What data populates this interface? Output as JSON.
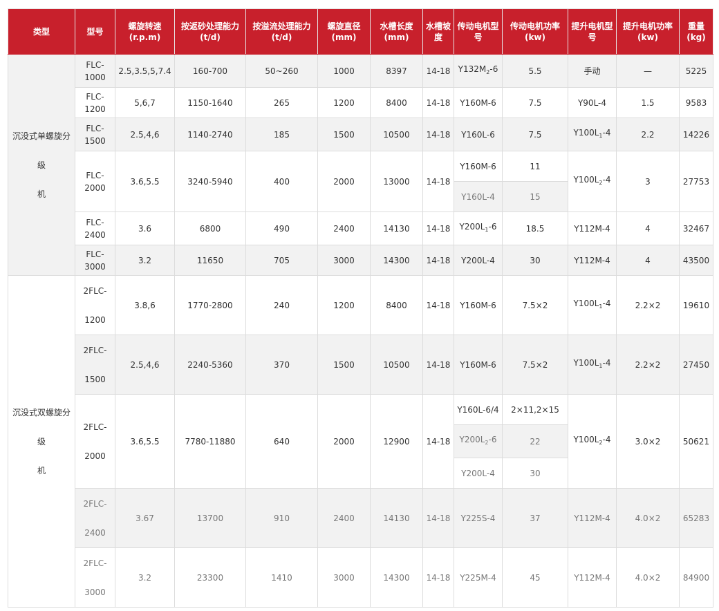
{
  "headers": [
    "类型",
    "型号",
    "螺旋转速\n(r.p.m)",
    "按返砂处理能力\n(t/d)",
    "按溢流处理能力\n(t/d)",
    "螺旋直径\n(mm)",
    "水槽长度\n(mm)",
    "水槽坡度",
    "传动电机型号",
    "传动电机功率\n(kw)",
    "提升电机型号",
    "提升电机功率\n(kw)",
    "重量\n(kg)"
  ],
  "categories": {
    "single_line1": "沉没式单螺旋分级",
    "single_line2": "机",
    "double_line1": "沉没式双螺旋分级",
    "double_line2": "机"
  },
  "rows": {
    "r1": {
      "model": "FLC-1000",
      "speed": "2.5,3.5,5,7.4",
      "sand": "160-700",
      "overflow": "50~260",
      "diam": "1000",
      "length": "8397",
      "slope": "14-18",
      "drive_model": "Y132M",
      "drive_sub": "2",
      "drive_tail": "-6",
      "drive_power": "5.5",
      "lift_model": "手动",
      "lift_power": "—",
      "weight": "5225"
    },
    "r2": {
      "model": "FLC-1200",
      "speed": "5,6,7",
      "sand": "1150-1640",
      "overflow": "265",
      "diam": "1200",
      "length": "8400",
      "slope": "14-18",
      "drive_model": "Y160M-6",
      "drive_power": "7.5",
      "lift_model": "Y90L-4",
      "lift_power": "1.5",
      "weight": "9583"
    },
    "r3": {
      "model": "FLC-1500",
      "speed": "2.5,4,6",
      "sand": "1140-2740",
      "overflow": "185",
      "diam": "1500",
      "length": "10500",
      "slope": "14-18",
      "drive_model": "Y160L-6",
      "drive_power": "7.5",
      "lift_model": "Y100L",
      "lift_sub": "1",
      "lift_tail": "-4",
      "lift_power": "2.2",
      "weight": "14226"
    },
    "r4": {
      "model": "FLC-2000",
      "speed": "3.6,5.5",
      "sand": "3240-5940",
      "overflow": "400",
      "diam": "2000",
      "length": "13000",
      "slope": "14-18",
      "drive_model_a": "Y160M-6",
      "drive_power_a": "11",
      "drive_model_b": "Y160L-4",
      "drive_power_b": "15",
      "lift_model": "Y100L",
      "lift_sub": "2",
      "lift_tail": "-4",
      "lift_power": "3",
      "weight": "27753"
    },
    "r5": {
      "model": "FLC-2400",
      "speed": "3.6",
      "sand": "6800",
      "overflow": "490",
      "diam": "2400",
      "length": "14130",
      "slope": "14-18",
      "drive_model": "Y200L",
      "drive_sub": "1",
      "drive_tail": "-6",
      "drive_power": "18.5",
      "lift_model": "Y112M-4",
      "lift_power": "4",
      "weight": "32467"
    },
    "r6": {
      "model": "FLC-3000",
      "speed": "3.2",
      "sand": "11650",
      "overflow": "705",
      "diam": "3000",
      "length": "14300",
      "slope": "14-18",
      "drive_model": "Y200L-4",
      "drive_power": "30",
      "lift_model": "Y112M-4",
      "lift_power": "4",
      "weight": "43500"
    },
    "r7": {
      "model_a": "2FLC-",
      "model_b": "1200",
      "speed": "3.8,6",
      "sand": "1770-2800",
      "overflow": "240",
      "diam": "1200",
      "length": "8400",
      "slope": "14-18",
      "drive_model": "Y160M-6",
      "drive_power": "7.5×2",
      "lift_model": "Y100L",
      "lift_sub": "1",
      "lift_tail": "-4",
      "lift_power": "2.2×2",
      "weight": "19610"
    },
    "r8": {
      "model_a": "2FLC-",
      "model_b": "1500",
      "speed": "2.5,4,6",
      "sand": "2240-5360",
      "overflow": "370",
      "diam": "1500",
      "length": "10500",
      "slope": "14-18",
      "drive_model": "Y160M-6",
      "drive_power": "7.5×2",
      "lift_model": "Y100L",
      "lift_sub": "1",
      "lift_tail": "-4",
      "lift_power": "2.2×2",
      "weight": "27450"
    },
    "r9": {
      "model_a": "2FLC-",
      "model_b": "2000",
      "speed": "3.6,5.5",
      "sand": "7780-11880",
      "overflow": "640",
      "diam": "2000",
      "length": "12900",
      "slope": "14-18",
      "drive_model_a": "Y160L-6/4",
      "drive_power_a": "2×11,2×15",
      "drive_model_b": "Y200L",
      "drive_sub_b": "2",
      "drive_tail_b": "-6",
      "drive_power_b": "22",
      "drive_model_c": "Y200L-4",
      "drive_power_c": "30",
      "lift_model": "Y100L",
      "lift_sub": "2",
      "lift_tail": "-4",
      "lift_power": "3.0×2",
      "weight": "50621"
    },
    "r10": {
      "model_a": "2FLC-",
      "model_b": "2400",
      "speed": "3.67",
      "sand": "13700",
      "overflow": "910",
      "diam": "2400",
      "length": "14130",
      "slope": "14-18",
      "drive_model": "Y225S-4",
      "drive_power": "37",
      "lift_model": "Y112M-4",
      "lift_power": "4.0×2",
      "weight": "65283"
    },
    "r11": {
      "model_a": "2FLC-",
      "model_b": "3000",
      "speed": "3.2",
      "sand": "23300",
      "overflow": "1410",
      "diam": "3000",
      "length": "14300",
      "slope": "14-18",
      "drive_model": "Y225M-4",
      "drive_power": "45",
      "lift_model": "Y112M-4",
      "lift_power": "4.0×2",
      "weight": "84900"
    }
  }
}
